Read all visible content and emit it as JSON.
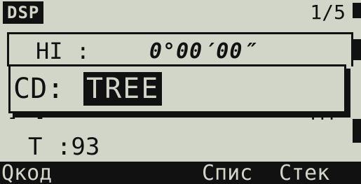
{
  "header": {
    "mode": "DSP",
    "page": "1/5"
  },
  "hi": {
    "label": "HI :",
    "value": "0°00′00″"
  },
  "popup": {
    "label": "CD:",
    "value": "TREE"
  },
  "background": {
    "dashes": "- -",
    "ellipsis": "..."
  },
  "t_row": {
    "text": "T :93"
  },
  "softkeys": [
    {
      "label": "Qкод"
    },
    {
      "label": "Спис"
    },
    {
      "label": "Стек"
    }
  ]
}
